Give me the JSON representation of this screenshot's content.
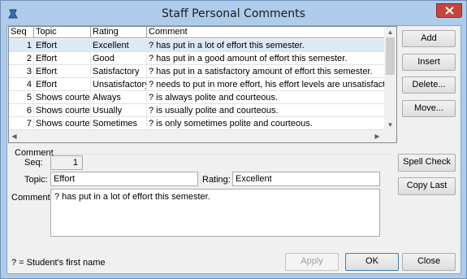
{
  "window": {
    "title": "Staff Personal Comments",
    "accent": "#aecbea",
    "close_color": "#c7463a"
  },
  "grid": {
    "columns": [
      "Seq",
      "Topic",
      "Rating",
      "Comment"
    ],
    "rows": [
      {
        "seq": "1",
        "topic": "Effort",
        "rating": "Excellent",
        "comment": "? has put in a lot of effort this semester."
      },
      {
        "seq": "2",
        "topic": "Effort",
        "rating": "Good",
        "comment": "? has put in a good amount of effort this semester."
      },
      {
        "seq": "3",
        "topic": "Effort",
        "rating": "Satisfactory",
        "comment": "? has put in a satisfactory amount of effort this semester."
      },
      {
        "seq": "4",
        "topic": "Effort",
        "rating": "Unsatisfactory",
        "comment": "? needs to put in more effort, his effort levels are unsatisfactory."
      },
      {
        "seq": "5",
        "topic": "Shows courtesy",
        "rating": "Always",
        "comment": "? is always polite and courteous."
      },
      {
        "seq": "6",
        "topic": "Shows courtesy",
        "rating": "Usually",
        "comment": "? is usually polite and courteous."
      },
      {
        "seq": "7",
        "topic": "Shows courtesy",
        "rating": "Sometimes",
        "comment": "? is only sometimes polite and courteous."
      }
    ]
  },
  "side_buttons": {
    "add": "Add",
    "insert": "Insert",
    "delete": "Delete...",
    "move": "Move..."
  },
  "detail": {
    "group_label": "Comment",
    "seq_label": "Seq:",
    "seq_value": "1",
    "topic_label": "Topic:",
    "topic_value": "Effort",
    "rating_label": "Rating:",
    "rating_value": "Excellent",
    "comment_label": "Comment:",
    "comment_value": "? has put in a lot of effort this semester."
  },
  "detail_buttons": {
    "spell_check": "Spell Check",
    "copy_last": "Copy Last"
  },
  "footer": {
    "legend": "? = Student's first name",
    "apply": "Apply",
    "ok": "OK",
    "close": "Close"
  },
  "icons": [
    "app-icon",
    "close-icon",
    "scroll-up-icon",
    "scroll-down-icon",
    "scroll-left-icon",
    "scroll-right-icon"
  ]
}
